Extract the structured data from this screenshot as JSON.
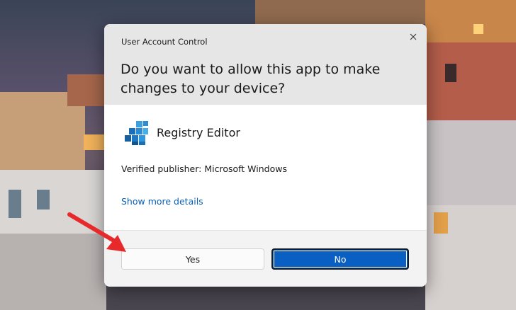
{
  "dialog": {
    "caption": "User Account Control",
    "question": "Do you want to allow this app to make changes to your device?",
    "app_name": "Registry Editor",
    "publisher": "Verified publisher: Microsoft Windows",
    "more_details": "Show more details",
    "yes_label": "Yes",
    "no_label": "No"
  },
  "icons": {
    "close": "close-icon",
    "app": "registry-editor-icon",
    "annotation": "red-arrow-annotation"
  },
  "colors": {
    "primary_button": "#0a5fc2",
    "link": "#0a5fb5",
    "header_bg": "#e6e6e6",
    "annotation_arrow": "#e8292b"
  }
}
